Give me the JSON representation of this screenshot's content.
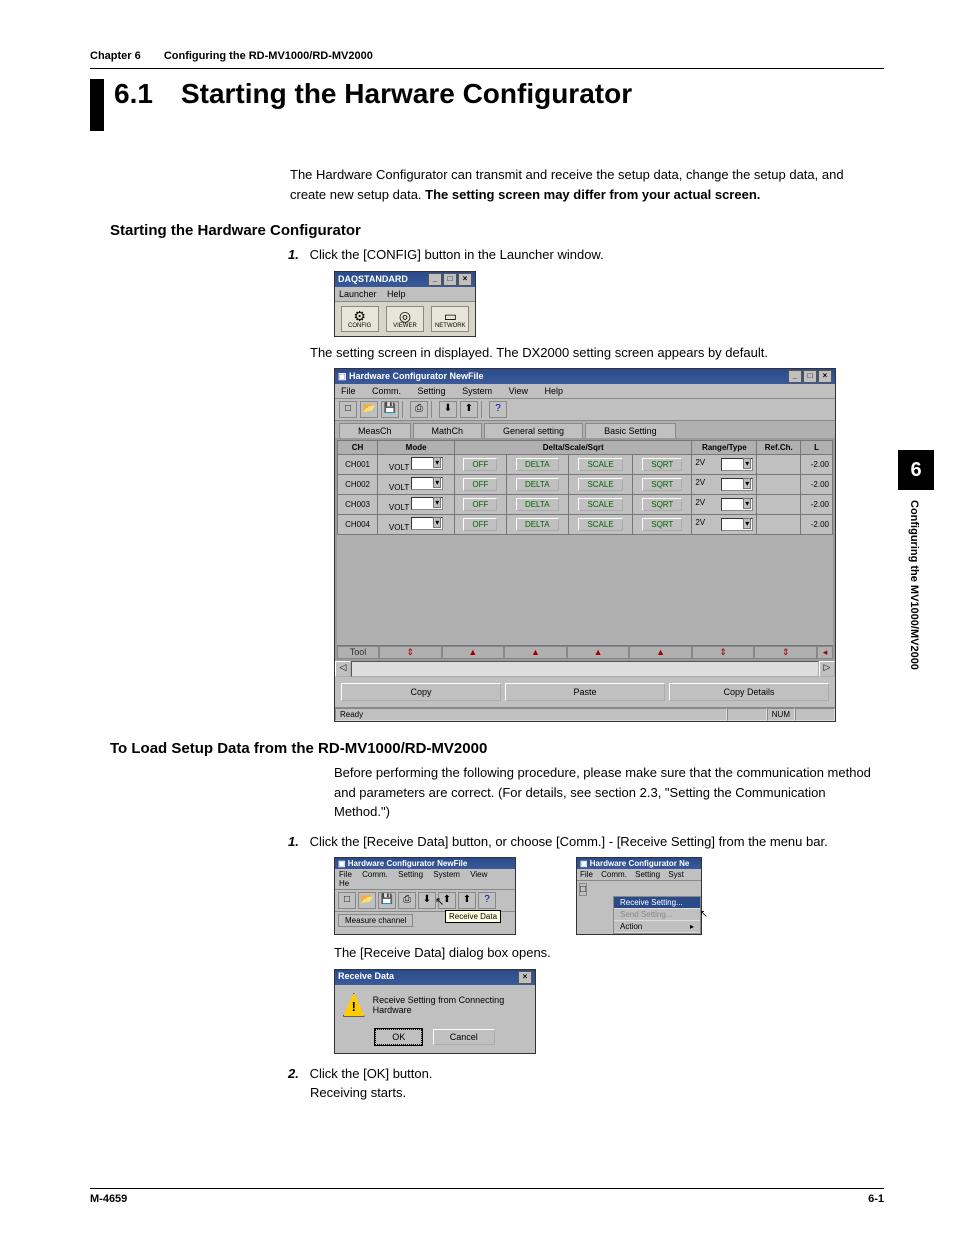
{
  "chapter": {
    "label": "Chapter 6",
    "title": "Configuring the RD-MV1000/RD-MV2000"
  },
  "section": {
    "number": "6.1",
    "title": "Starting the Harware Configurator"
  },
  "intro": {
    "line1": "The Hardware Configurator can transmit and receive the setup data, change the setup data, and create new setup data.  ",
    "bold": "The setting screen may differ from your actual screen."
  },
  "sub1": "Starting the Hardware Configurator",
  "step1": {
    "num": "1.",
    "text": "Click the [CONFIG] button in the Launcher window."
  },
  "launcher": {
    "title": "DAQSTANDARD",
    "menu": {
      "m1": "Launcher",
      "m2": "Help"
    },
    "icons": {
      "c1": "CONFIG",
      "c2": "VIEWER",
      "c3": "NETWORK"
    }
  },
  "step1b": "The setting screen in displayed. The DX2000 setting screen appears by default.",
  "hw": {
    "title": "Hardware Configurator NewFile",
    "menu": {
      "m1": "File",
      "m2": "Comm.",
      "m3": "Setting",
      "m4": "System",
      "m5": "View",
      "m6": "Help"
    },
    "tabs": {
      "t1": "MeasCh",
      "t2": "MathCh",
      "t3": "General setting",
      "t4": "Basic Setting"
    },
    "cols": {
      "c1": "CH",
      "c2": "Mode",
      "c3": "Delta/Scale/Sqrt",
      "c4": "Range/Type",
      "c5": "Ref.Ch.",
      "c6": "L"
    },
    "rows": [
      {
        "ch": "CH001",
        "mode": "VOLT",
        "off": "OFF",
        "d": "DELTA",
        "s": "SCALE",
        "q": "SQRT",
        "r": "2V",
        "v": "-2.00"
      },
      {
        "ch": "CH002",
        "mode": "VOLT",
        "off": "OFF",
        "d": "DELTA",
        "s": "SCALE",
        "q": "SQRT",
        "r": "2V",
        "v": "-2.00"
      },
      {
        "ch": "CH003",
        "mode": "VOLT",
        "off": "OFF",
        "d": "DELTA",
        "s": "SCALE",
        "q": "SQRT",
        "r": "2V",
        "v": "-2.00"
      },
      {
        "ch": "CH004",
        "mode": "VOLT",
        "off": "OFF",
        "d": "DELTA",
        "s": "SCALE",
        "q": "SQRT",
        "r": "2V",
        "v": "-2.00"
      }
    ],
    "toolrow_label": "Tool",
    "btns": {
      "b1": "Copy",
      "b2": "Paste",
      "b3": "Copy Details"
    },
    "status": {
      "ready": "Ready",
      "num": "NUM"
    }
  },
  "sub2": "To Load Setup Data from the RD-MV1000/RD-MV2000",
  "load_intro": "Before performing the following procedure, please make sure that the communication method and parameters are correct.  (For details, see section 2.3, \"Setting the Communication Method.\")",
  "step_l1": {
    "num": "1.",
    "text": "Click the [Receive Data] button, or choose [Comm.] - [Receive Setting] from the menu bar."
  },
  "hwsmall": {
    "title": "Hardware Configurator NewFile",
    "menu": {
      "m1": "File",
      "m2": "Comm.",
      "m3": "Setting",
      "m4": "System",
      "m5": "View",
      "m6": "He"
    },
    "tab": "Measure channel",
    "tooltip": "Receive Data"
  },
  "hwmenu": {
    "title": "Hardware Configurator Ne",
    "menu": {
      "m1": "File",
      "m2": "Comm.",
      "m3": "Setting",
      "m4": "Syst"
    },
    "items": {
      "i1": "Receive Setting...",
      "i2": "Send Setting...",
      "i3": "Action",
      "arrow": "▸"
    }
  },
  "dlg_opens": "The [Receive Data] dialog box opens.",
  "recv": {
    "title": "Receive Data",
    "msg": "Receive Setting from Connecting Hardware",
    "ok": "OK",
    "cancel": "Cancel"
  },
  "step_l2": {
    "num": "2.",
    "text": "Click the [OK] button.",
    "text2": "Receiving starts."
  },
  "side": {
    "num": "6",
    "text": "Configuring the MV1000/MV2000"
  },
  "footer": {
    "left": "M-4659",
    "right": "6-1"
  }
}
